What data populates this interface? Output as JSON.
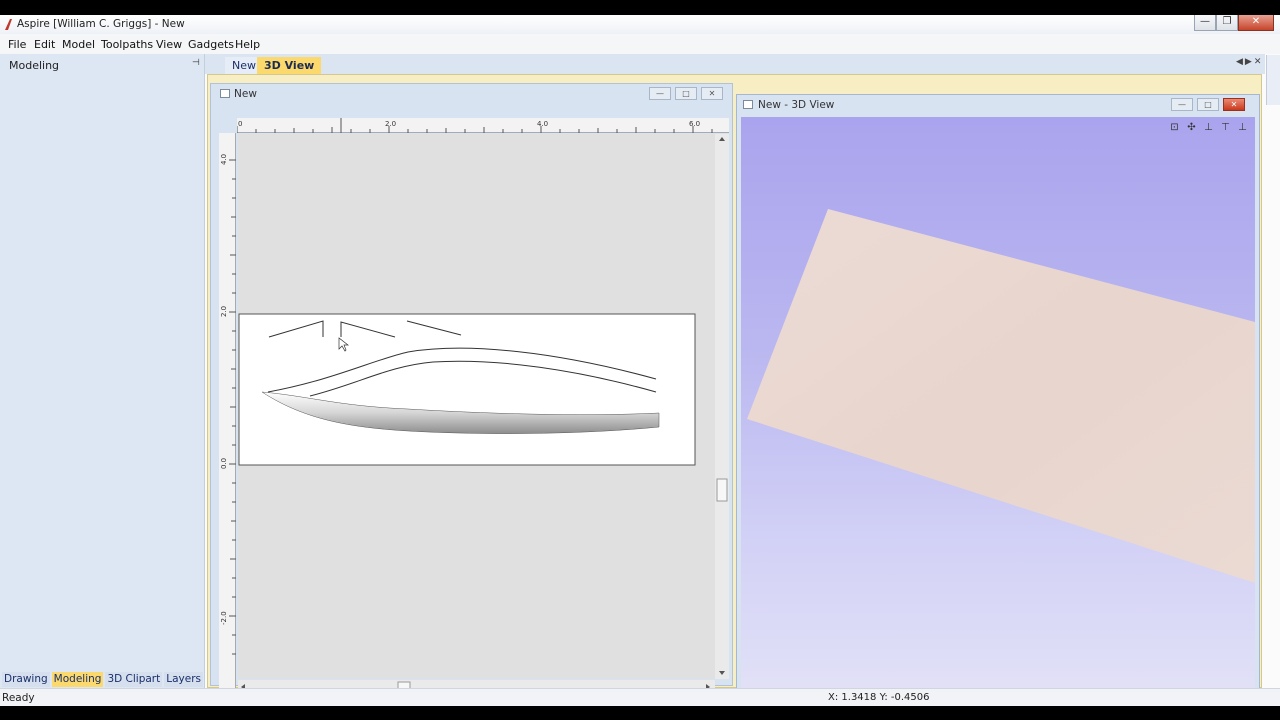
{
  "window": {
    "title": "Aspire [William C. Griggs] - New",
    "buttons": [
      "minimize",
      "restore",
      "close"
    ]
  },
  "menu": [
    "File",
    "Edit",
    "Model",
    "Toolpaths",
    "View",
    "Gadgets",
    "Help"
  ],
  "left_panel": {
    "title": "Modeling",
    "pin_glyph": "⊣",
    "tabs": [
      {
        "label": "Drawing",
        "active": false
      },
      {
        "label": "Modeling",
        "active": true
      },
      {
        "label": "3D Clipart",
        "active": false
      },
      {
        "label": "Layers",
        "active": false
      }
    ]
  },
  "doc_tabs": [
    {
      "label": "New",
      "active": false
    },
    {
      "label": "3D View",
      "active": true
    }
  ],
  "view2d": {
    "title": "New",
    "ruler_top_labels": [
      "0",
      "2.0",
      "4.0",
      "6.0"
    ],
    "ruler_left_labels": [
      "4.0",
      "2.0",
      "0.0",
      "-2.0"
    ]
  },
  "view3d": {
    "title": "New - 3D View",
    "tool_icons": [
      "zoom-all-icon",
      "pan-icon",
      "view-iso-icon",
      "view-top-icon",
      "view-front-icon"
    ]
  },
  "status": {
    "left": "Ready",
    "coords": "X: 1.3418 Y: -0.4506"
  },
  "colors": {
    "accent_tab": "#fbd96c",
    "panel_bg": "#dde6f3",
    "workspace_frame": "#f7eec3",
    "view3d_sky_top": "#aaa4ee",
    "board_color": "#ecd7d0"
  }
}
